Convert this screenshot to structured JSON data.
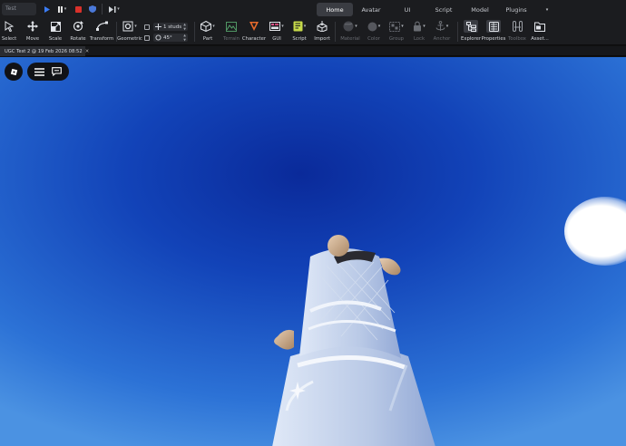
{
  "menubar": {
    "search_text": "Test",
    "tabs": [
      {
        "label": "Home",
        "active": true
      },
      {
        "label": "Avatar",
        "active": false
      },
      {
        "label": "UI",
        "active": false
      },
      {
        "label": "Script",
        "active": false
      },
      {
        "label": "Model",
        "active": false
      },
      {
        "label": "Plugins",
        "active": false
      }
    ],
    "more_caret": "▾"
  },
  "ribbon": {
    "select": "Select",
    "move": "Move",
    "scale": "Scale",
    "rotate": "Rotate",
    "transform": "Transform",
    "geometric": "Geometric",
    "snap_move": "1 studs",
    "snap_rotate": "45°",
    "part": "Part",
    "terrain": "Terrain",
    "character": "Character",
    "gui": "GUI",
    "script": "Script",
    "import": "Import",
    "material": "Material",
    "color": "Color",
    "group": "Group",
    "lock": "Lock",
    "anchor": "Anchor",
    "explorer": "Explorer",
    "properties": "Properties",
    "toolbox": "Toolbox",
    "assets": "Asset..."
  },
  "document": {
    "tab_title": "UGC Test 2 @ 19 Feb 2026 08:52",
    "close": "✕"
  },
  "colors": {
    "chrome": "#1b1c1f",
    "sky_deep": "#0a2a9a",
    "sky_light": "#4b92e2",
    "play_blue": "#3b7cf5",
    "stop_red": "#d9312b"
  }
}
